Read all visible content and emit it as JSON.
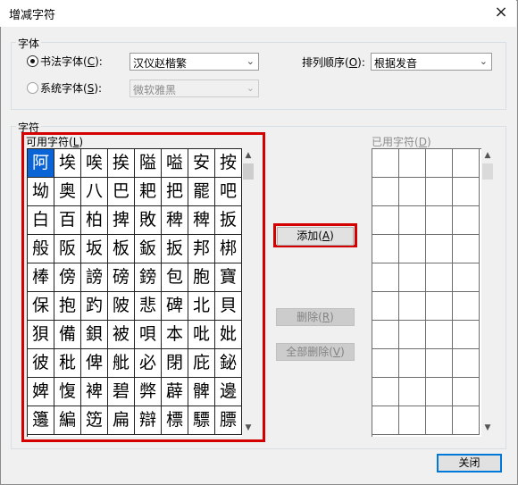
{
  "window": {
    "title": "增减字符"
  },
  "font_group": {
    "legend": "字体",
    "calligraphy": {
      "label_pre": "书法字体(",
      "key": "C",
      "label_post": "):",
      "value": "汉仪赵楷繁",
      "selected": true
    },
    "system": {
      "label_pre": "系统字体(",
      "key": "S",
      "label_post": "):",
      "value": "微软雅黑",
      "selected": false
    },
    "sort": {
      "label_pre": "排列顺序(",
      "key": "O",
      "label_post": "):",
      "value": "根据发音"
    }
  },
  "chars_group": {
    "legend": "字符",
    "available": {
      "label_pre": "可用字符(",
      "key": "L",
      "label_post": ")"
    },
    "used": {
      "label_pre": "已用字符(",
      "key": "D",
      "label_post": ")"
    }
  },
  "available_chars": [
    "阿",
    "埃",
    "唉",
    "挨",
    "隘",
    "嗌",
    "安",
    "按",
    "坳",
    "奥",
    "八",
    "巴",
    "耙",
    "把",
    "罷",
    "吧",
    "白",
    "百",
    "柏",
    "捭",
    "敗",
    "稗",
    "稗",
    "扳",
    "般",
    "阪",
    "坂",
    "板",
    "鈑",
    "扳",
    "邦",
    "梆",
    "棒",
    "傍",
    "謗",
    "磅",
    "鎊",
    "包",
    "胞",
    "寶",
    "保",
    "抱",
    "趵",
    "陂",
    "悲",
    "碑",
    "北",
    "貝",
    "狽",
    "備",
    "鋇",
    "被",
    "唄",
    "本",
    "吡",
    "妣",
    "彼",
    "秕",
    "俾",
    "舭",
    "必",
    "閉",
    "庇",
    "鉍",
    "婢",
    "愎",
    "裨",
    "碧",
    "弊",
    "薜",
    "髀",
    "邊",
    "籩",
    "編",
    "笾",
    "扁",
    "辯",
    "標",
    "驃",
    "膘"
  ],
  "buttons": {
    "add": {
      "label": "添加(",
      "key": "A",
      "post": ")"
    },
    "remove": {
      "label": "删除(",
      "key": "R",
      "post": ")"
    },
    "remove_all": {
      "label": "全部删除(",
      "key": "V",
      "post": ")"
    },
    "close": "关闭"
  },
  "icons": {
    "close": "×",
    "combo_arrow": "⌄",
    "scroll_up": "▲",
    "scroll_down": "▼"
  },
  "colors": {
    "selection": "#0a64d6",
    "highlight_border": "#d40000"
  }
}
